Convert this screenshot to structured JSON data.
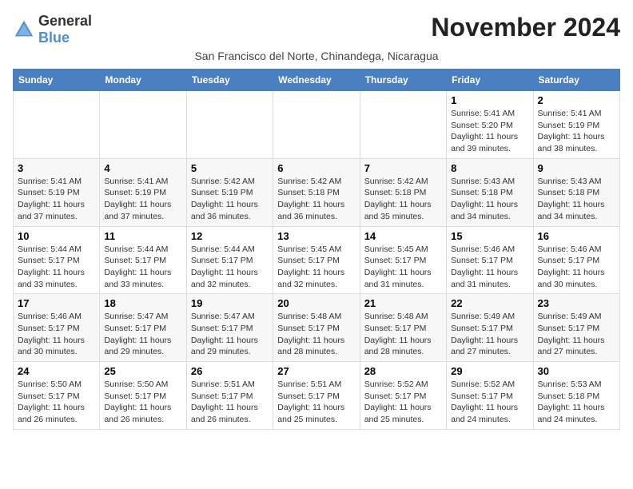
{
  "logo": {
    "text_general": "General",
    "text_blue": "Blue"
  },
  "title": "November 2024",
  "subtitle": "San Francisco del Norte, Chinandega, Nicaragua",
  "days_of_week": [
    "Sunday",
    "Monday",
    "Tuesday",
    "Wednesday",
    "Thursday",
    "Friday",
    "Saturday"
  ],
  "weeks": [
    [
      {
        "day": "",
        "info": ""
      },
      {
        "day": "",
        "info": ""
      },
      {
        "day": "",
        "info": ""
      },
      {
        "day": "",
        "info": ""
      },
      {
        "day": "",
        "info": ""
      },
      {
        "day": "1",
        "info": "Sunrise: 5:41 AM\nSunset: 5:20 PM\nDaylight: 11 hours and 39 minutes."
      },
      {
        "day": "2",
        "info": "Sunrise: 5:41 AM\nSunset: 5:19 PM\nDaylight: 11 hours and 38 minutes."
      }
    ],
    [
      {
        "day": "3",
        "info": "Sunrise: 5:41 AM\nSunset: 5:19 PM\nDaylight: 11 hours and 37 minutes."
      },
      {
        "day": "4",
        "info": "Sunrise: 5:41 AM\nSunset: 5:19 PM\nDaylight: 11 hours and 37 minutes."
      },
      {
        "day": "5",
        "info": "Sunrise: 5:42 AM\nSunset: 5:19 PM\nDaylight: 11 hours and 36 minutes."
      },
      {
        "day": "6",
        "info": "Sunrise: 5:42 AM\nSunset: 5:18 PM\nDaylight: 11 hours and 36 minutes."
      },
      {
        "day": "7",
        "info": "Sunrise: 5:42 AM\nSunset: 5:18 PM\nDaylight: 11 hours and 35 minutes."
      },
      {
        "day": "8",
        "info": "Sunrise: 5:43 AM\nSunset: 5:18 PM\nDaylight: 11 hours and 34 minutes."
      },
      {
        "day": "9",
        "info": "Sunrise: 5:43 AM\nSunset: 5:18 PM\nDaylight: 11 hours and 34 minutes."
      }
    ],
    [
      {
        "day": "10",
        "info": "Sunrise: 5:44 AM\nSunset: 5:17 PM\nDaylight: 11 hours and 33 minutes."
      },
      {
        "day": "11",
        "info": "Sunrise: 5:44 AM\nSunset: 5:17 PM\nDaylight: 11 hours and 33 minutes."
      },
      {
        "day": "12",
        "info": "Sunrise: 5:44 AM\nSunset: 5:17 PM\nDaylight: 11 hours and 32 minutes."
      },
      {
        "day": "13",
        "info": "Sunrise: 5:45 AM\nSunset: 5:17 PM\nDaylight: 11 hours and 32 minutes."
      },
      {
        "day": "14",
        "info": "Sunrise: 5:45 AM\nSunset: 5:17 PM\nDaylight: 11 hours and 31 minutes."
      },
      {
        "day": "15",
        "info": "Sunrise: 5:46 AM\nSunset: 5:17 PM\nDaylight: 11 hours and 31 minutes."
      },
      {
        "day": "16",
        "info": "Sunrise: 5:46 AM\nSunset: 5:17 PM\nDaylight: 11 hours and 30 minutes."
      }
    ],
    [
      {
        "day": "17",
        "info": "Sunrise: 5:46 AM\nSunset: 5:17 PM\nDaylight: 11 hours and 30 minutes."
      },
      {
        "day": "18",
        "info": "Sunrise: 5:47 AM\nSunset: 5:17 PM\nDaylight: 11 hours and 29 minutes."
      },
      {
        "day": "19",
        "info": "Sunrise: 5:47 AM\nSunset: 5:17 PM\nDaylight: 11 hours and 29 minutes."
      },
      {
        "day": "20",
        "info": "Sunrise: 5:48 AM\nSunset: 5:17 PM\nDaylight: 11 hours and 28 minutes."
      },
      {
        "day": "21",
        "info": "Sunrise: 5:48 AM\nSunset: 5:17 PM\nDaylight: 11 hours and 28 minutes."
      },
      {
        "day": "22",
        "info": "Sunrise: 5:49 AM\nSunset: 5:17 PM\nDaylight: 11 hours and 27 minutes."
      },
      {
        "day": "23",
        "info": "Sunrise: 5:49 AM\nSunset: 5:17 PM\nDaylight: 11 hours and 27 minutes."
      }
    ],
    [
      {
        "day": "24",
        "info": "Sunrise: 5:50 AM\nSunset: 5:17 PM\nDaylight: 11 hours and 26 minutes."
      },
      {
        "day": "25",
        "info": "Sunrise: 5:50 AM\nSunset: 5:17 PM\nDaylight: 11 hours and 26 minutes."
      },
      {
        "day": "26",
        "info": "Sunrise: 5:51 AM\nSunset: 5:17 PM\nDaylight: 11 hours and 26 minutes."
      },
      {
        "day": "27",
        "info": "Sunrise: 5:51 AM\nSunset: 5:17 PM\nDaylight: 11 hours and 25 minutes."
      },
      {
        "day": "28",
        "info": "Sunrise: 5:52 AM\nSunset: 5:17 PM\nDaylight: 11 hours and 25 minutes."
      },
      {
        "day": "29",
        "info": "Sunrise: 5:52 AM\nSunset: 5:17 PM\nDaylight: 11 hours and 24 minutes."
      },
      {
        "day": "30",
        "info": "Sunrise: 5:53 AM\nSunset: 5:18 PM\nDaylight: 11 hours and 24 minutes."
      }
    ]
  ]
}
